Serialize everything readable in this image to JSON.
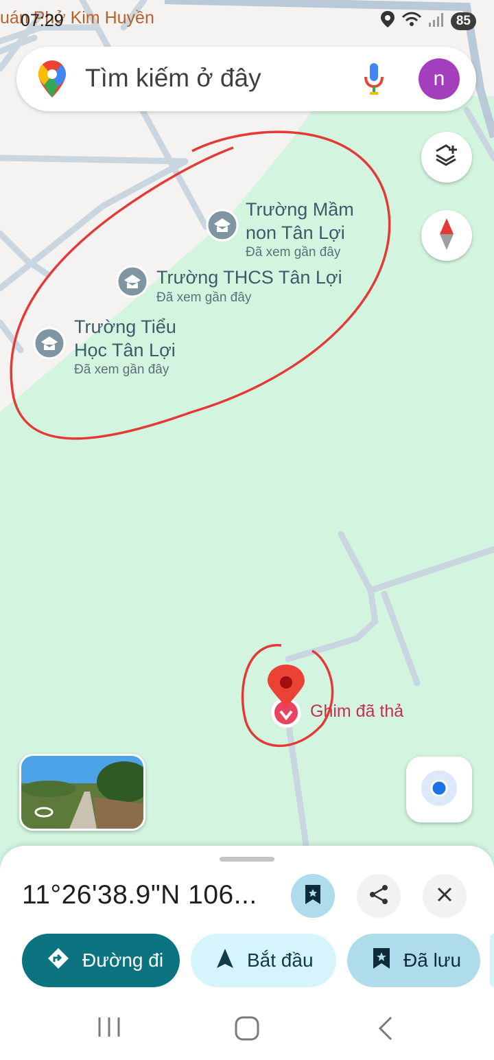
{
  "status_bar": {
    "shop_label": "uán Phở Kim Huyền",
    "time": "07:29",
    "battery": "85"
  },
  "search": {
    "placeholder": "Tìm kiếm ở đây",
    "avatar_letter": "n"
  },
  "map_controls": {
    "layers_icon": "layers-plus-icon",
    "compass_icon": "compass-icon",
    "my_location_icon": "my-location-icon"
  },
  "pois": [
    {
      "name": "Trường Mầm non Tân Lợi",
      "name_line1": "Trường Mầm",
      "name_line2": "non Tân Lợi",
      "subtitle": "Đã xem gần đây",
      "icon": "school-icon"
    },
    {
      "name": "Trường THCS Tân Lợi",
      "subtitle": "Đã xem gần đây",
      "icon": "school-icon"
    },
    {
      "name": "Trường Tiểu Học Tân Lợi",
      "name_line1": "Trường Tiểu",
      "name_line2": "Học Tân Lợi",
      "subtitle": "Đã xem gần đây",
      "icon": "school-icon"
    }
  ],
  "dropped_pin": {
    "label": "Ghim đã thả",
    "color": "#ea4335"
  },
  "place_sheet": {
    "title": "11°26'38.9\"N 106...",
    "actions": {
      "save_icon": "bookmark-icon",
      "share_icon": "share-icon",
      "close_icon": "close-icon"
    },
    "chips": [
      {
        "label": "Đường đi",
        "icon": "directions-icon"
      },
      {
        "label": "Bắt đầu",
        "icon": "navigation-arrow-icon"
      },
      {
        "label": "Đã lưu",
        "icon": "bookmark-icon"
      }
    ]
  },
  "colors": {
    "map_green": "#d3f5e0",
    "map_built_area": "#f1f3f4",
    "road": "#c6d3de",
    "annotation_red": "#e53935",
    "primary_teal": "#0b7480",
    "chip_light": "#d5f4fb",
    "chip_saved": "#aedcea"
  }
}
